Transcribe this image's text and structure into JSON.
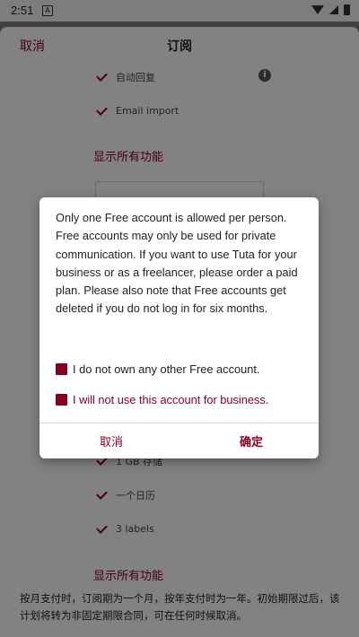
{
  "status_bar": {
    "time": "2:51",
    "notification_icon": "A"
  },
  "header": {
    "cancel_label": "取消",
    "title": "订阅"
  },
  "features_top": [
    {
      "label": "自动回复"
    },
    {
      "label": "Email import"
    }
  ],
  "show_all_label": "显示所有功能",
  "features_bottom": [
    {
      "label": "1 GB 存储"
    },
    {
      "label": "一个日历"
    },
    {
      "label": "3 labels"
    }
  ],
  "footer_text": "按月支付时，订阅期为一个月，按年支付时为一年。初始期限过后，该计划将转为非固定期限合同，可在任何时候取消。",
  "dialog": {
    "message": "Only one Free account is allowed per person. Free accounts may only be used for private communication. If you want to use Tuta for your business or as a freelancer, please order a paid plan. Please also note that Free accounts get deleted if you do not log in for six months.",
    "checkbox_1": "I do not own any other Free account.",
    "checkbox_2": "I will not use this account for business.",
    "cancel_label": "取消",
    "confirm_label": "确定"
  }
}
